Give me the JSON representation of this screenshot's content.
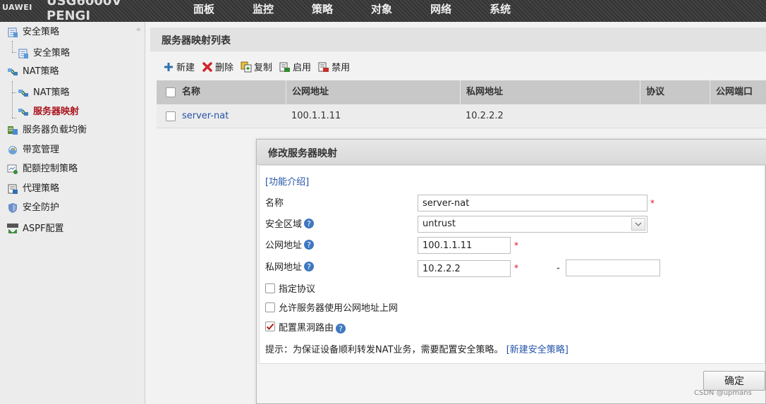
{
  "header": {
    "brand_logo": "UAWEI",
    "brand_model": "USG6000V PENGI",
    "nav": [
      "面板",
      "监控",
      "策略",
      "对象",
      "网络",
      "系统"
    ]
  },
  "sidebar": {
    "collapse_glyph": "«",
    "items": [
      {
        "label": "安全策略",
        "icon": "policy-icon"
      },
      {
        "label": "安全策略",
        "icon": "policy-icon"
      },
      {
        "label": "NAT策略",
        "icon": "nat-icon"
      },
      {
        "label": "NAT策略",
        "icon": "nat-icon"
      },
      {
        "label": "服务器映射",
        "icon": "nat-icon"
      },
      {
        "label": "服务器负载均衡",
        "icon": "server-lb-icon"
      },
      {
        "label": "带宽管理",
        "icon": "bandwidth-icon"
      },
      {
        "label": "配额控制策略",
        "icon": "quota-icon"
      },
      {
        "label": "代理策略",
        "icon": "proxy-icon"
      },
      {
        "label": "安全防护",
        "icon": "shield-icon"
      },
      {
        "label": "ASPF配置",
        "icon": "aspf-icon"
      }
    ]
  },
  "list": {
    "title": "服务器映射列表",
    "toolbar": {
      "new": "新建",
      "delete": "删除",
      "copy": "复制",
      "enable": "启用",
      "disable": "禁用"
    },
    "columns": [
      "名称",
      "公网地址",
      "私网地址",
      "协议",
      "公网端口"
    ],
    "rows": [
      {
        "name": "server-nat",
        "public_ip": "100.1.1.11",
        "private_ip": "10.2.2.2",
        "protocol": "",
        "public_port": ""
      }
    ]
  },
  "dialog": {
    "title": "修改服务器映射",
    "intro_link": "[功能介绍]",
    "fields": {
      "name_label": "名称",
      "name_value": "server-nat",
      "zone_label": "安全区域",
      "zone_value": "untrust",
      "public_label": "公网地址",
      "public_value": "100.1.1.11",
      "private_label": "私网地址",
      "private_value": "10.2.2.2",
      "private_end_value": "",
      "range_dash": "-",
      "required_mark": "*"
    },
    "options": {
      "protocol": {
        "label": "指定协议",
        "checked": false
      },
      "allow_public": {
        "label": "允许服务器使用公网地址上网",
        "checked": false
      },
      "blackhole": {
        "label": "配置黑洞路由",
        "checked": true
      }
    },
    "hint": "提示：为保证设备顺利转发NAT业务，需要配置安全策略。",
    "hint_link": "[新建安全策略]",
    "ok_label": "确定"
  },
  "watermark": "CSDN @upmans",
  "colors": {
    "active_item": "#a8141c",
    "link": "#2553a8",
    "required": "#dd1122"
  }
}
